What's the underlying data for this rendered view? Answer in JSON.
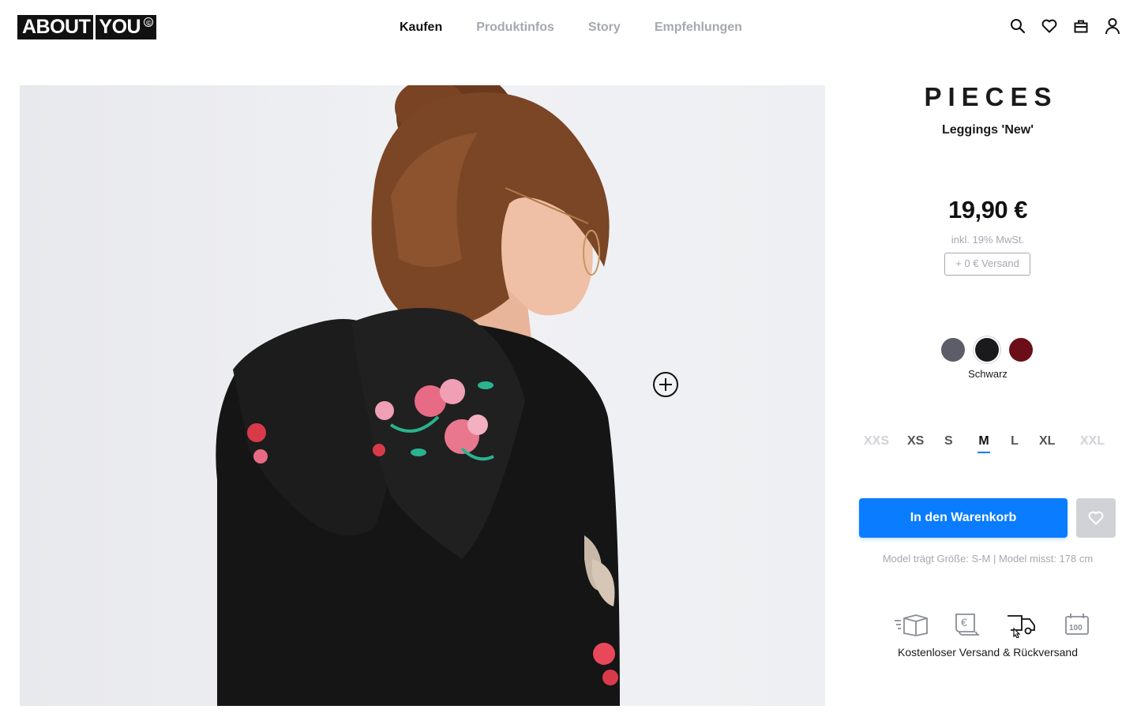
{
  "header": {
    "logo": {
      "part1": "ABOUT",
      "part2": "YOU",
      "mark": "©"
    },
    "nav": [
      {
        "label": "Kaufen",
        "active": true
      },
      {
        "label": "Produktinfos",
        "active": false
      },
      {
        "label": "Story",
        "active": false
      },
      {
        "label": "Empfehlungen",
        "active": false
      }
    ],
    "icons": [
      "search-icon",
      "heart-icon",
      "bag-icon",
      "user-icon"
    ]
  },
  "product": {
    "image_alt_icon": "zoom-plus-icon",
    "brand": "PIECES",
    "name": "Leggings 'New'",
    "price": "19,90 €",
    "vat": "inkl. 19% MwSt.",
    "shipping": "+ 0 € Versand",
    "colors": [
      {
        "hex": "#5c5d68",
        "selected": false
      },
      {
        "hex": "#1a1a1c",
        "selected": true
      },
      {
        "hex": "#6b0e18",
        "selected": false
      }
    ],
    "selected_color_label": "Schwarz",
    "sizes": [
      {
        "label": "XXS",
        "state": "disabled"
      },
      {
        "label": "XS",
        "state": "available"
      },
      {
        "label": "S",
        "state": "available"
      },
      {
        "label": "M",
        "state": "selected"
      },
      {
        "label": "L",
        "state": "available"
      },
      {
        "label": "XL",
        "state": "available"
      },
      {
        "label": "XXL",
        "state": "disabled"
      }
    ],
    "cart_button": "In den Warenkorb",
    "model_info": "Model trägt Größe: S-M | Model misst: 178 cm",
    "service_icons": [
      "fast-delivery-box-icon",
      "invoice-euro-icon",
      "free-shipping-truck-icon",
      "return-100-days-icon"
    ],
    "service_label": "Kostenloser Versand & Rückversand"
  },
  "colors": {
    "accent": "#0a7cff",
    "muted": "#a5a8b0",
    "text": "#111111"
  }
}
